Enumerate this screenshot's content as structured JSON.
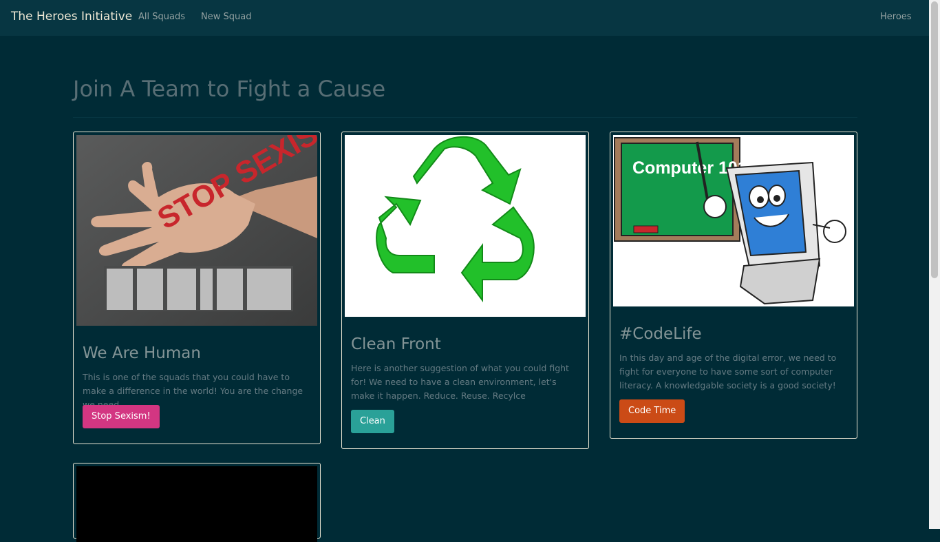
{
  "navbar": {
    "brand": "The Heroes Initiative",
    "links": [
      "All Squads",
      "New Squad"
    ],
    "right_link": "Heroes"
  },
  "page": {
    "title": "Join A Team to Fight a Cause"
  },
  "squads": [
    {
      "image_label": "STOP SEXISM",
      "title": "We Are Human",
      "description": "This is one of the squads that you could have to make a difference in the world! You are the change we need.",
      "button": "Stop Sexism!",
      "button_color": "#d33682"
    },
    {
      "title": "Clean Front",
      "description": "Here is another suggestion of what you could fight for! We need to have a clean environment, let's make it happen. Reduce. Reuse. Recylce",
      "button": "Clean",
      "button_color": "#2aa198"
    },
    {
      "image_label": "Computer 101",
      "title": "#CodeLife",
      "description": "In this day and age of the digital error, we need to fight for everyone to have some sort of computer literacy. A knowledgable society is a good society!",
      "button": "Code Time",
      "button_color": "#cb4b16"
    }
  ],
  "colors": {
    "background": "#002b36",
    "navbar": "#073642",
    "card_border": "#eee8d5"
  }
}
